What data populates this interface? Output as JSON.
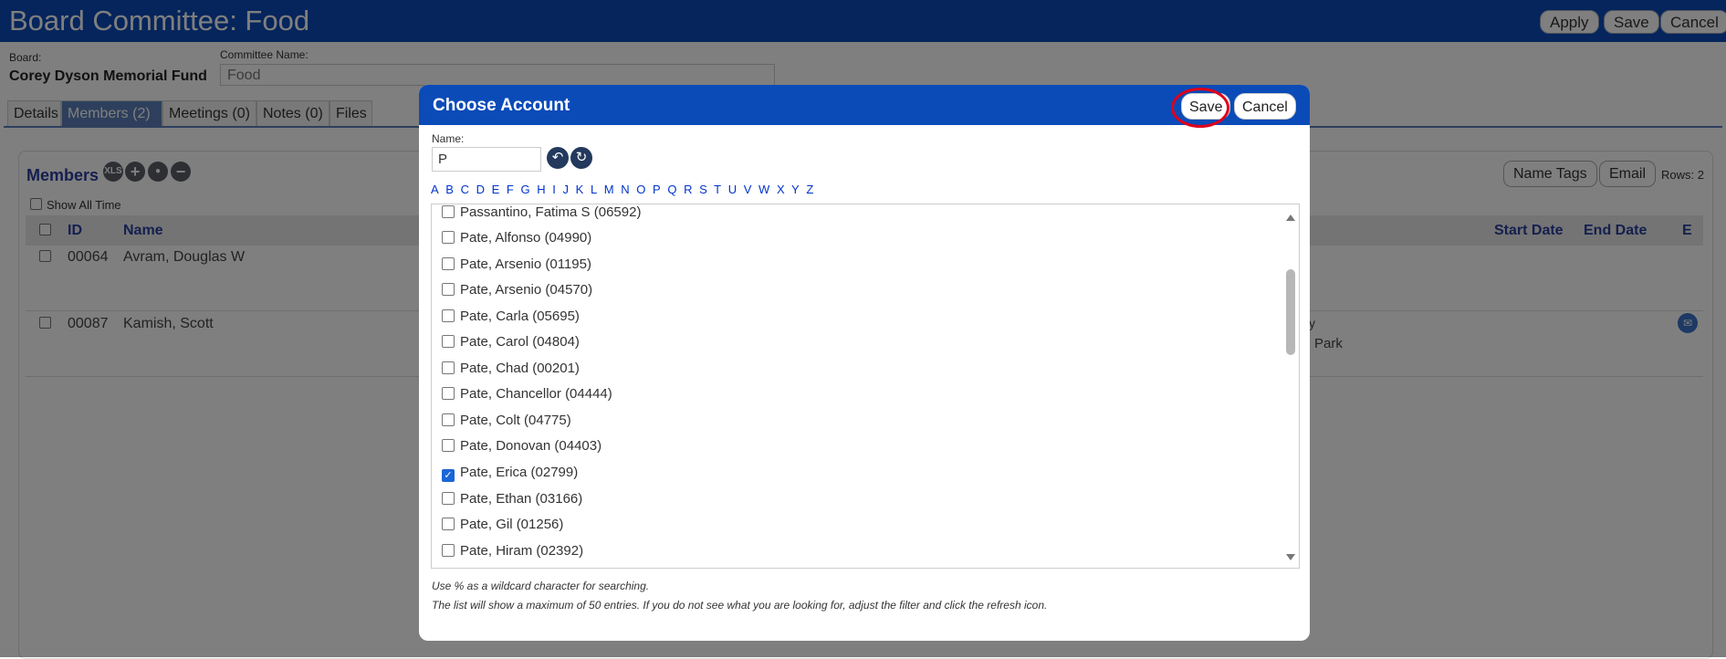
{
  "page": {
    "title": "Board Committee: Food",
    "buttons": {
      "apply": "Apply",
      "save": "Save",
      "cancel": "Cancel"
    },
    "board_label": "Board:",
    "board_value": "Corey Dyson Memorial Fund",
    "committee_label": "Committee Name:",
    "committee_value": "Food",
    "tabs": [
      {
        "label": "Details"
      },
      {
        "label": "Members (2)"
      },
      {
        "label": "Meetings (0)"
      },
      {
        "label": "Notes (0)"
      },
      {
        "label": "Files"
      }
    ],
    "members": {
      "title": "Members",
      "xls_icon": "XLS",
      "show_all_time": "Show All Time",
      "name_tags": "Name Tags",
      "email": "Email",
      "rows": "Rows: 2",
      "columns": {
        "id": "ID",
        "name": "Name",
        "start_date": "Start Date",
        "end_date": "End Date",
        "e": "E"
      },
      "rows_data": [
        {
          "id": "00064",
          "name": "Avram, Douglas W",
          "extra1": "",
          "extra2": ""
        },
        {
          "id": "00087",
          "name": "Kamish, Scott",
          "extra1": "y",
          "extra2": "Park"
        }
      ]
    }
  },
  "modal": {
    "title": "Choose Account",
    "save": "Save",
    "cancel": "Cancel",
    "name_label": "Name:",
    "name_value": "P",
    "letters": [
      "A",
      "B",
      "C",
      "D",
      "E",
      "F",
      "G",
      "H",
      "I",
      "J",
      "K",
      "L",
      "M",
      "N",
      "O",
      "P",
      "Q",
      "R",
      "S",
      "T",
      "U",
      "V",
      "W",
      "X",
      "Y",
      "Z"
    ],
    "items": [
      {
        "label": "Passantino, Fatima S (06592)",
        "checked": false
      },
      {
        "label": "Pate, Alfonso (04990)",
        "checked": false
      },
      {
        "label": "Pate, Arsenio (01195)",
        "checked": false
      },
      {
        "label": "Pate, Arsenio (04570)",
        "checked": false
      },
      {
        "label": "Pate, Carla (05695)",
        "checked": false
      },
      {
        "label": "Pate, Carol (04804)",
        "checked": false
      },
      {
        "label": "Pate, Chad (00201)",
        "checked": false
      },
      {
        "label": "Pate, Chancellor (04444)",
        "checked": false
      },
      {
        "label": "Pate, Colt (04775)",
        "checked": false
      },
      {
        "label": "Pate, Donovan (04403)",
        "checked": false
      },
      {
        "label": "Pate, Erica (02799)",
        "checked": true
      },
      {
        "label": "Pate, Ethan (03166)",
        "checked": false
      },
      {
        "label": "Pate, Gil (01256)",
        "checked": false
      },
      {
        "label": "Pate, Hiram (02392)",
        "checked": false
      }
    ],
    "hint1": "Use % as a wildcard character for searching.",
    "hint2": "The list will show a maximum of 50 entries. If you do not see what you are looking for, adjust the filter and click the refresh icon."
  },
  "colors": {
    "header_blue": "#0a4bb8",
    "highlight_ring": "#e0001b",
    "link_blue": "#0033cc"
  },
  "icons": [
    "undo-icon",
    "refresh-icon",
    "add-icon",
    "user-icon",
    "remove-icon",
    "mail-icon",
    "xls-icon"
  ]
}
